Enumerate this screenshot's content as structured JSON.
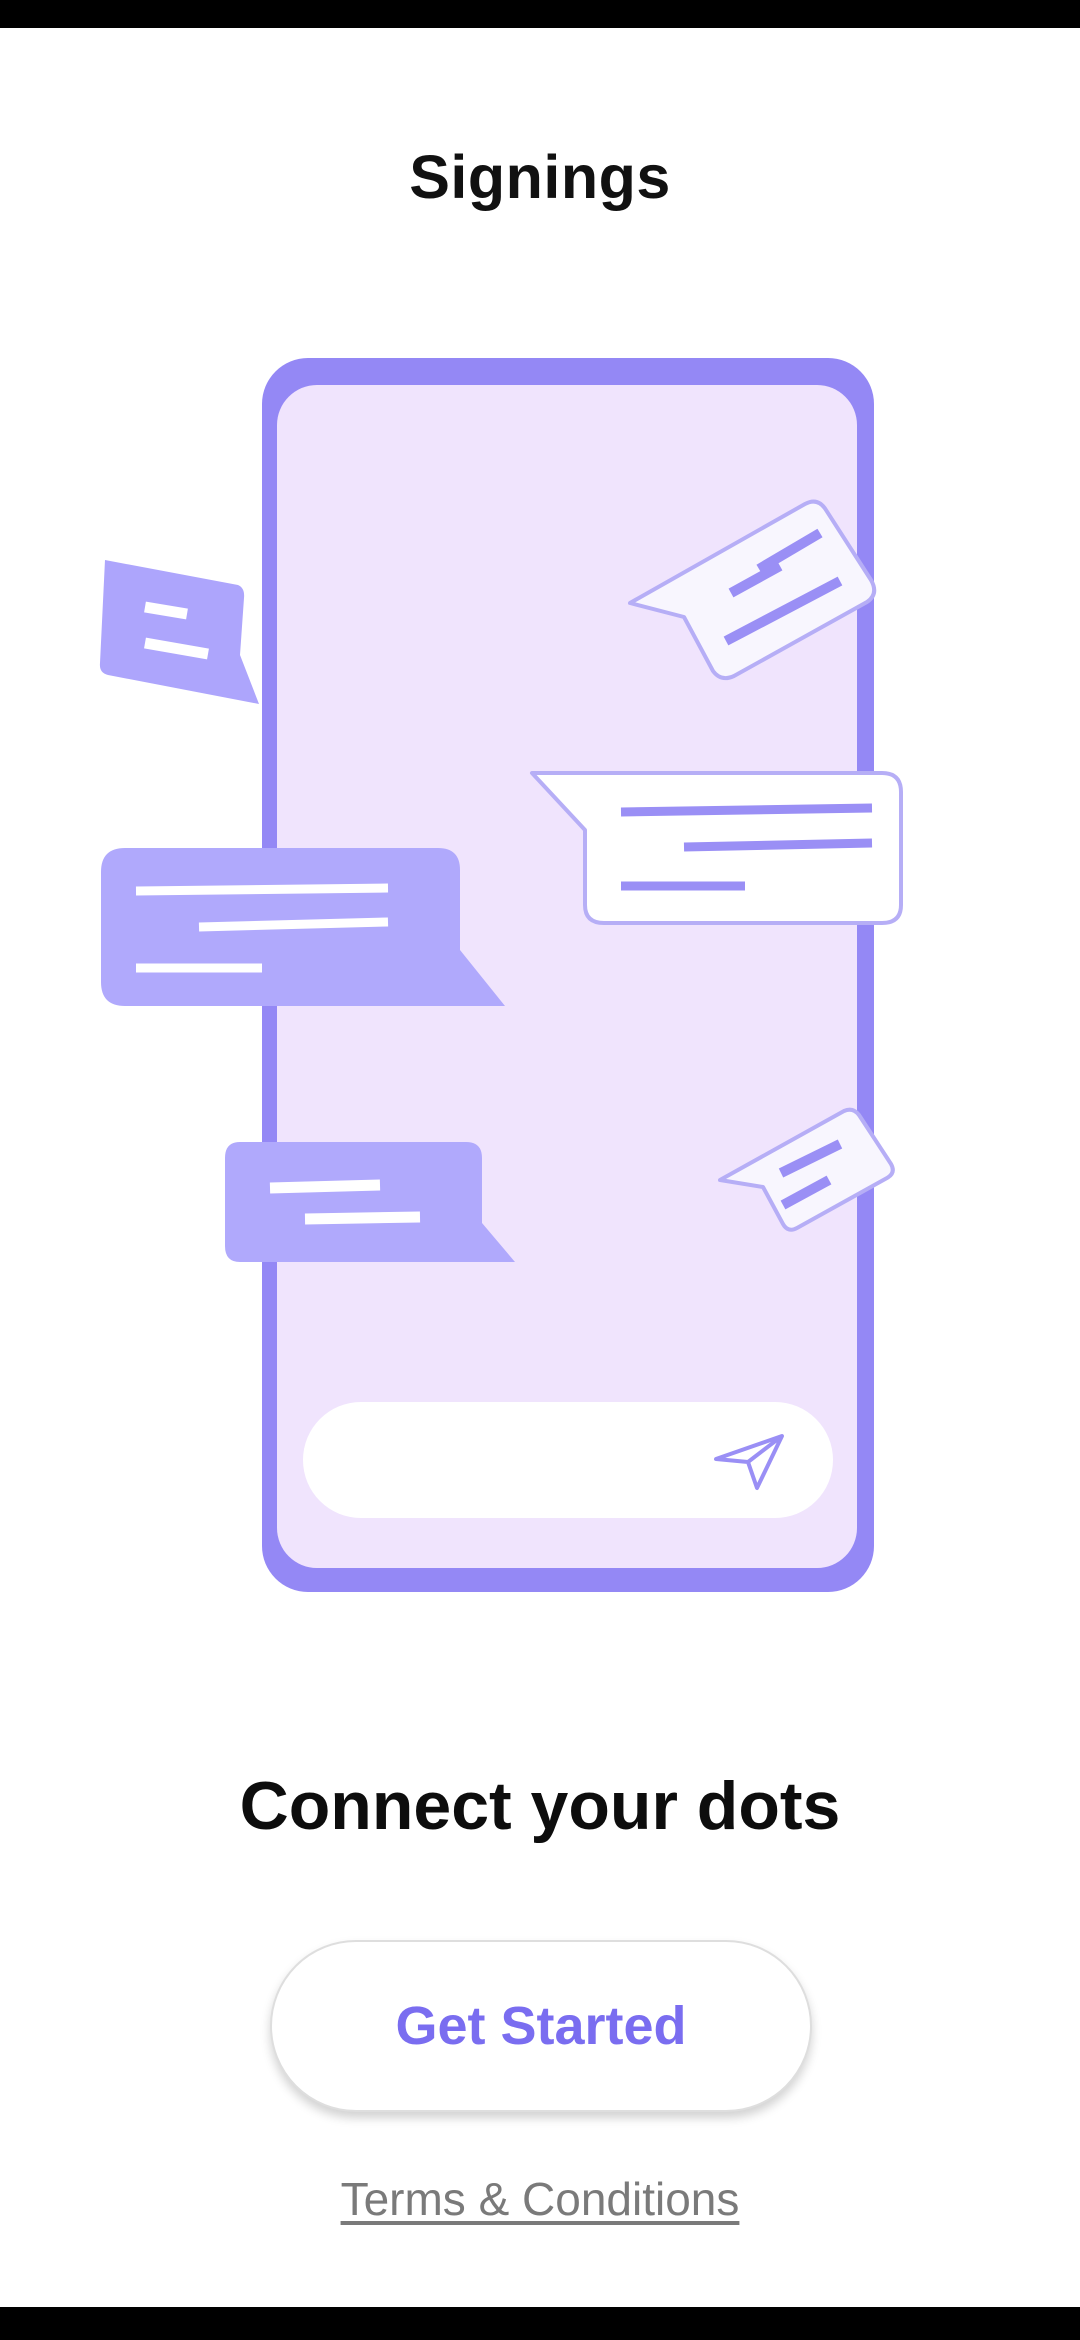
{
  "app": {
    "title": "Signings"
  },
  "onboarding": {
    "headline": "Connect your dots",
    "primary_button_label": "Get Started",
    "terms_link_label": "Terms & Conditions"
  },
  "illustration": {
    "subject": "phone-with-chat-bubbles",
    "icons": [
      "send-icon"
    ]
  },
  "colors": {
    "accent": "#7a6df0",
    "phone_frame": "#9488f5",
    "phone_screen": "#f0e4fd",
    "bubble_fill": "#b0a9fc",
    "bubble_outline": "#b6aef6",
    "text_dark": "#111111",
    "text_muted": "#7a7a7a"
  }
}
